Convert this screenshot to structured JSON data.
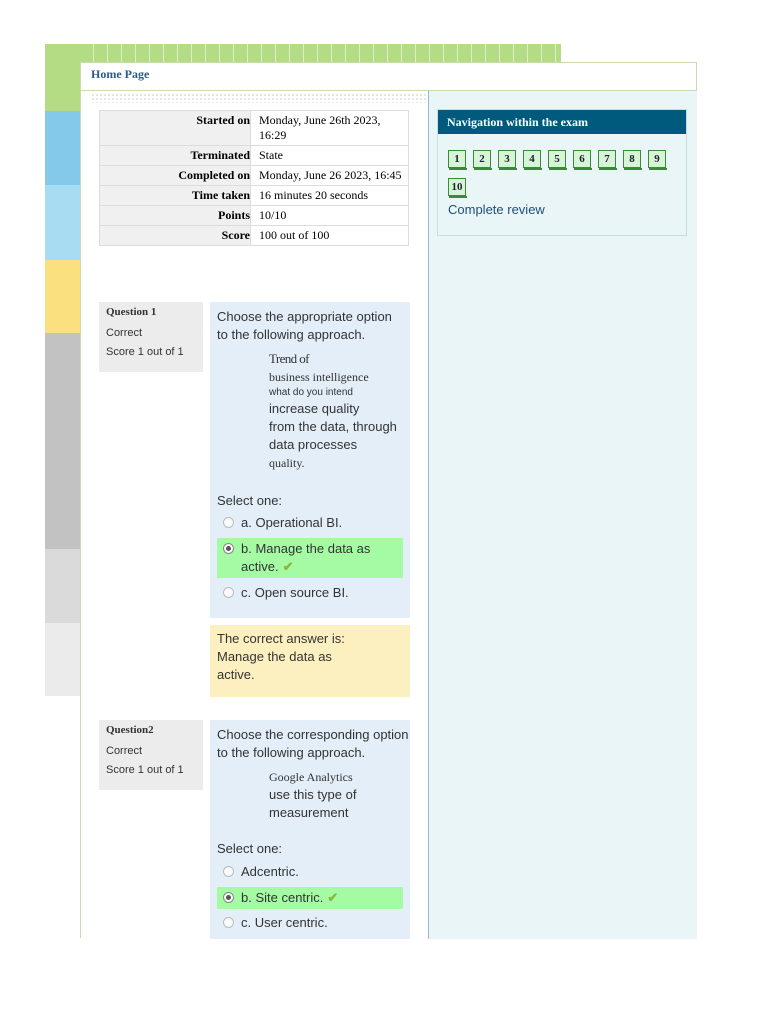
{
  "header": {
    "home_link": "Home Page"
  },
  "summary": [
    {
      "label": "Started on",
      "value": "Monday, June 26th 2023, 16:29"
    },
    {
      "label": "Terminated",
      "value": "State"
    },
    {
      "label": "Completed on",
      "value": "Monday, June 26 2023, 16:45"
    },
    {
      "label": "Time taken",
      "value": "16 minutes 20 seconds"
    },
    {
      "label": "Points",
      "value": "10/10"
    },
    {
      "label": "Score",
      "value": "100 out of 100"
    }
  ],
  "questions": [
    {
      "number": "Question 1",
      "state": "Correct",
      "score": "Score 1 out of 1",
      "prompt": "Choose the appropriate option to the following approach.",
      "statement_lines": [
        "Trend of",
        "business intelligence",
        "what do you intend",
        "increase quality",
        "from the data, through",
        "data processes",
        "quality."
      ],
      "select_label": "Select one:",
      "options": [
        {
          "label": "a. Operational BI.",
          "selected": false
        },
        {
          "label": "b. Manage the data as active.",
          "selected": true
        },
        {
          "label": "c. Open source BI.",
          "selected": false
        }
      ],
      "feedback_lines": [
        "The correct answer is:",
        "Manage the data as",
        "active."
      ]
    },
    {
      "number": "Question2",
      "state": "Correct",
      "score": "Score 1 out of 1",
      "prompt": "Choose the corresponding option to the following approach.",
      "statement_lines": [
        "Google Analytics",
        "use this type of",
        "measurement"
      ],
      "select_label": "Select one:",
      "options": [
        {
          "label": "Adcentric.",
          "selected": false
        },
        {
          "label": "b. Site centric.",
          "selected": true
        },
        {
          "label": "c. User centric.",
          "selected": false
        }
      ]
    }
  ],
  "navigation": {
    "title": "Navigation within the exam",
    "pages": [
      "1",
      "2",
      "3",
      "4",
      "5",
      "6",
      "7",
      "8",
      "9",
      "10"
    ],
    "complete_review": "Complete review"
  },
  "colors": {
    "correct_highlight": "#a4fba4",
    "feedback_bg": "#fdf0c0",
    "question_bg": "#e3eef9",
    "nav_header": "#005a7d",
    "check_mark": "#8ab838"
  }
}
